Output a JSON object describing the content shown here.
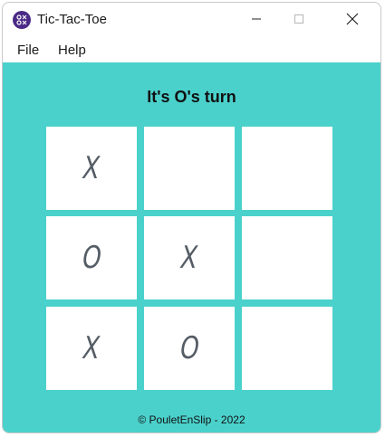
{
  "window": {
    "title": "Tic-Tac-Toe"
  },
  "menu": {
    "file": "File",
    "help": "Help"
  },
  "game": {
    "status": "It's O's turn",
    "board": [
      [
        "X",
        "",
        ""
      ],
      [
        "O",
        "X",
        ""
      ],
      [
        "X",
        "O",
        ""
      ]
    ]
  },
  "footer": {
    "text": "© PouletEnSlip - 2022"
  },
  "colors": {
    "background": "#4bd1cc",
    "cell": "#ffffff",
    "mark": "#555d66",
    "app_icon": "#4b2a86"
  },
  "icons": {
    "app": "tic-tac-toe-app-icon",
    "minimize": "minimize-icon",
    "maximize": "maximize-icon",
    "close": "close-icon"
  }
}
